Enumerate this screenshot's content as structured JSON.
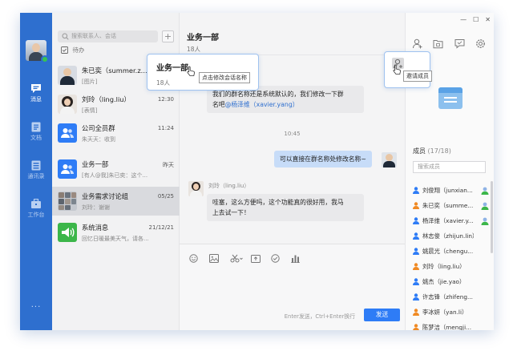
{
  "colors": {
    "nav_bg": "#2e6fcf",
    "accent": "#2e7cf6",
    "mention": "#2e6fcf",
    "bubble_right": "#c7dcf8"
  },
  "nav": {
    "items": [
      {
        "label": "消息",
        "icon": "message-icon",
        "active": true
      },
      {
        "label": "文档",
        "icon": "document-icon",
        "active": false
      },
      {
        "label": "通讯录",
        "icon": "contacts-icon",
        "active": false
      },
      {
        "label": "工作台",
        "icon": "workbench-icon",
        "active": false
      }
    ],
    "more": "···"
  },
  "list": {
    "search_placeholder": "搜索联系人、会话",
    "add_label": "+",
    "todo_label": "待办",
    "chats": [
      {
        "name": "朱已奕（summer.z...",
        "time": "",
        "preview": "[图片]"
      },
      {
        "name": "刘玲（ling.liu）",
        "time": "12:30",
        "preview": "[表情]"
      },
      {
        "name": "公司全员群",
        "time": "11:24",
        "preview": "朱天天：收到"
      },
      {
        "name": "业务一部",
        "time": "昨天",
        "preview": "[有人@我]朱已奕：这个..."
      },
      {
        "name": "业务需求讨论组",
        "time": "05/25",
        "preview": "刘玲：谢谢"
      },
      {
        "name": "系统消息",
        "time": "21/12/21",
        "preview": "回忆日暖最美天气，请各..."
      }
    ]
  },
  "main": {
    "title": "业务一部",
    "member_count": "18人",
    "messages": {
      "m1_line1": "我们的群名称还是系统默认的，我们修改一下群",
      "m1_line2_prefix": "名吧",
      "m1_mention": "@杨泽维（xavier.yang）",
      "time_divider": "10:45",
      "m2": "可以直接在群名称处修改名称~",
      "m3_sender": "刘玲（ling.liu）",
      "m3_line1": "哇塞，这么方便吗，这个功能真的很好用，我马",
      "m3_line2": "上去试一下！"
    },
    "send_hint": "Enter发送，Ctrl+Enter换行",
    "send_label": "发送"
  },
  "right": {
    "members_title": "成员",
    "members_count": "(17/18)",
    "search_placeholder": "搜索成员",
    "members": [
      {
        "name": "刘俊翔（junxian...",
        "color": "#2e7cf6",
        "badge": true
      },
      {
        "name": "朱已奕（summe...",
        "color": "#f08a24",
        "badge": true
      },
      {
        "name": "杨泽维（xavier.y...",
        "color": "#2e7cf6",
        "badge": true
      },
      {
        "name": "林志俊（zhijun.lin）",
        "color": "#2e7cf6",
        "badge": false
      },
      {
        "name": "姚晨光（chengu...",
        "color": "#2e7cf6",
        "badge": false
      },
      {
        "name": "刘玲（ling.liu）",
        "color": "#f08a24",
        "badge": false
      },
      {
        "name": "姚杰（jie.yao）",
        "color": "#2e7cf6",
        "badge": false
      },
      {
        "name": "许志锋（zhifeng...",
        "color": "#2e7cf6",
        "badge": false
      },
      {
        "name": "李冰妍（yan.li）",
        "color": "#f08a24",
        "badge": false
      },
      {
        "name": "陈梦洁（mengji...",
        "color": "#f08a24",
        "badge": false
      }
    ]
  },
  "callouts": {
    "rename_title": "业务一部",
    "rename_count": "18人",
    "rename_tip": "点击修改会话名称",
    "invite_tip": "邀请成员"
  }
}
